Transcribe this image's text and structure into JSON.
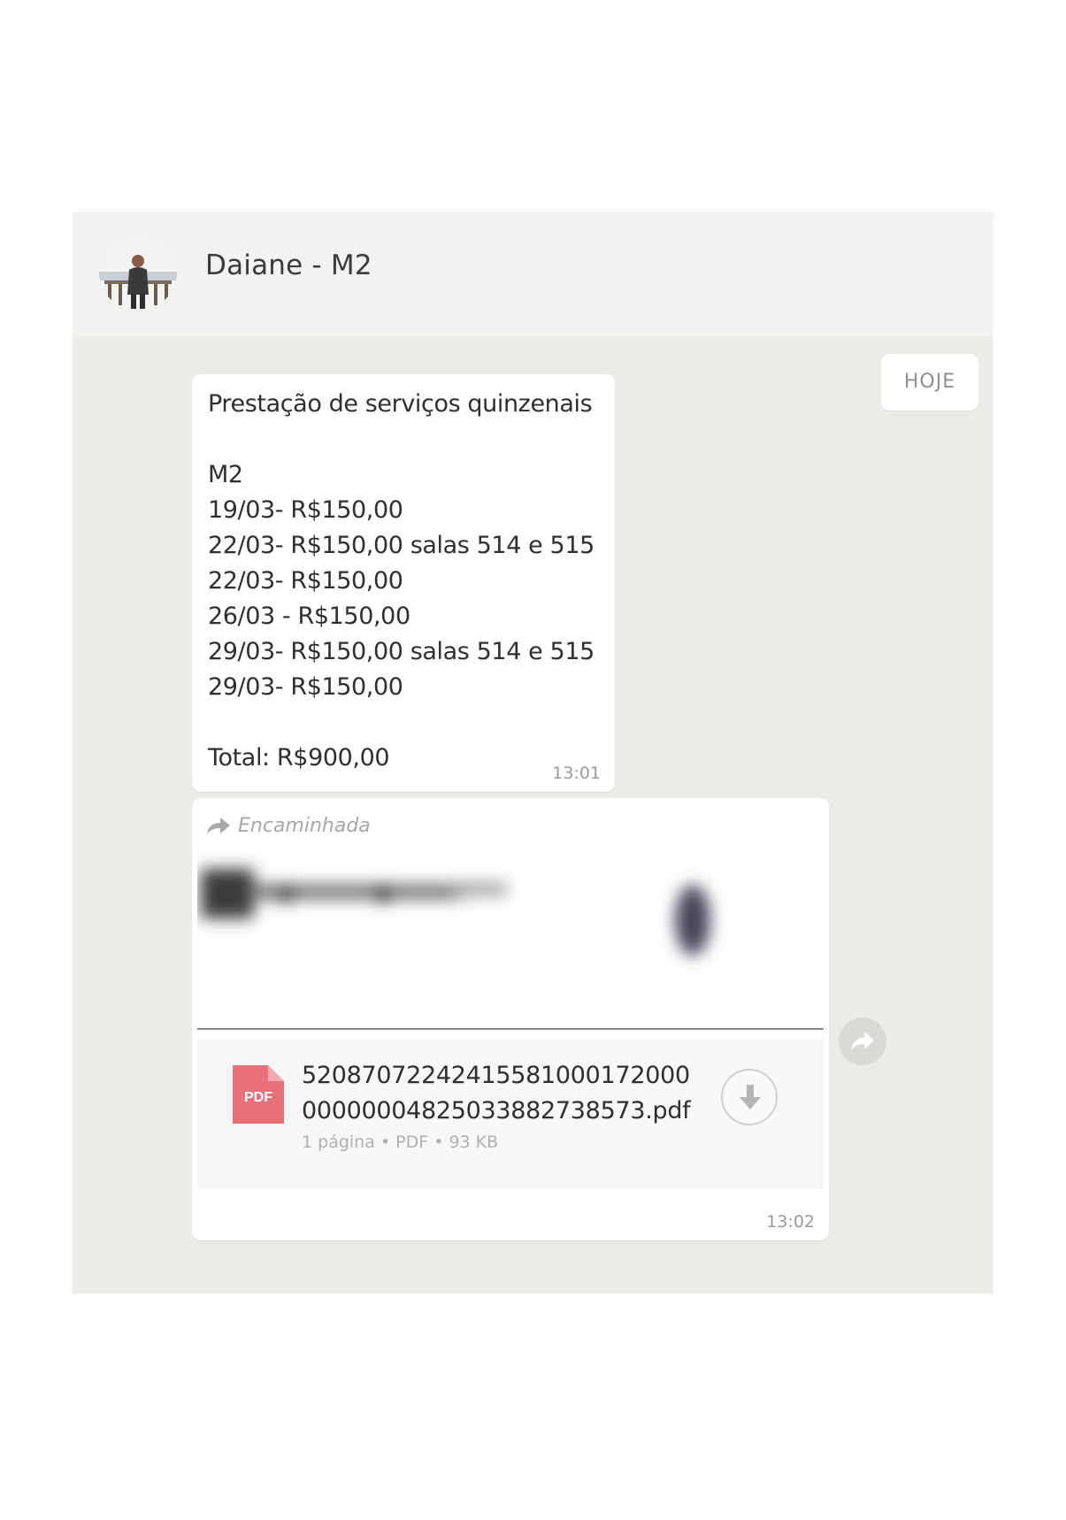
{
  "chat": {
    "contact_name": "Daiane - M2"
  },
  "date_chip": "HOJE",
  "messages": {
    "text_message": {
      "body": "Prestação de serviços quinzenais\n\nM2\n19/03- R$150,00\n22/03- R$150,00 salas 514 e 515\n22/03- R$150,00\n26/03 - R$150,00\n29/03- R$150,00 salas 514 e 515\n29/03- R$150,00\n\nTotal: R$900,00",
      "time": "13:01"
    },
    "document_message": {
      "forwarded_label": "Encaminhada",
      "file_name": "520870722424155810001720000000000482503388273857​3.pdf",
      "file_type_badge": "PDF",
      "meta": "1 página • PDF • 93 KB",
      "time": "13:02"
    }
  },
  "icons": {
    "forward": "forward-arrow-icon",
    "pdf": "pdf-file-icon",
    "download": "download-icon",
    "share": "share-icon"
  },
  "colors": {
    "chat_background": "#ecebe6",
    "bubble": "#ffffff",
    "pdf_badge": "#e8707a"
  }
}
